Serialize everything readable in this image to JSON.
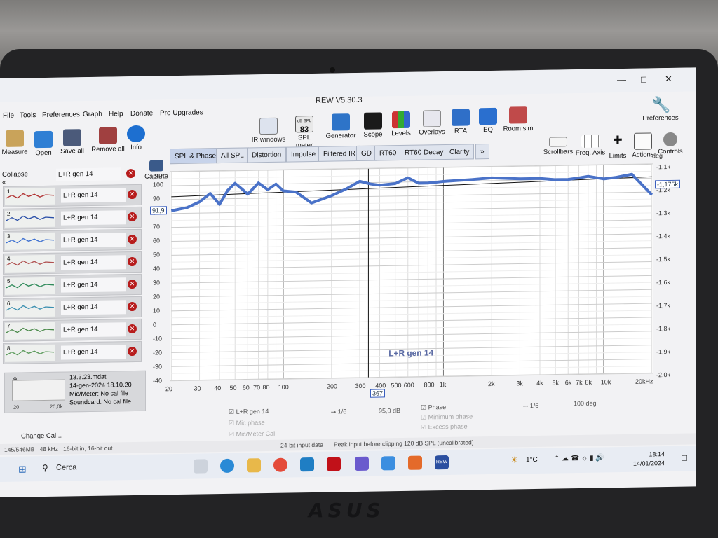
{
  "window": {
    "title": "REW V5.30.3"
  },
  "menu": [
    "File",
    "Tools",
    "Preferences",
    "Graph",
    "Help",
    "Donate",
    "Pro Upgrades"
  ],
  "toolbar_left": [
    "Measure",
    "Open",
    "Save all",
    "Remove all",
    "Info"
  ],
  "toolbar_center": [
    "IR windows",
    "SPL meter",
    "Generator",
    "Scope",
    "Levels",
    "Overlays",
    "RTA",
    "EQ",
    "Room sim"
  ],
  "spl_value": "83",
  "spl_icon_label": "dB SPL",
  "toolbar_right": [
    "Scrollbars",
    "Freq. Axis",
    "Limits",
    "Actions",
    "Controls"
  ],
  "preferences_label": "Preferences",
  "capture_label": "Capture",
  "sidebar": {
    "collapse_label": "Collapse",
    "top_name": "L+R gen 14",
    "items": [
      {
        "num": "1",
        "name": "L+R gen 14",
        "color": "#b03030"
      },
      {
        "num": "2",
        "name": "L+R gen 14",
        "color": "#2a4fa8"
      },
      {
        "num": "3",
        "name": "L+R gen 14",
        "color": "#3b6ed0"
      },
      {
        "num": "4",
        "name": "L+R gen 14",
        "color": "#b05050"
      },
      {
        "num": "5",
        "name": "L+R gen 14",
        "color": "#2f8a5a"
      },
      {
        "num": "6",
        "name": "L+R gen 14",
        "color": "#3a8fb0"
      },
      {
        "num": "7",
        "name": "L+R gen 14",
        "color": "#4a8a4a"
      },
      {
        "num": "8",
        "name": "L+R gen 14",
        "color": "#5a9a5a"
      }
    ],
    "details": {
      "num": "9",
      "file": "13.3.23.mdat",
      "date": "14-gen-2024 18.10.20",
      "mic": "Mic/Meter: No cal file",
      "sound": "Soundcard: No cal file",
      "range_start": "20",
      "range_end": "20,0k"
    },
    "change_cal": "Change Cal..."
  },
  "tabs": [
    "SPL & Phase",
    "All SPL",
    "Distortion",
    "Impulse",
    "Filtered IR",
    "GD",
    "RT60",
    "RT60 Decay",
    "Clarity",
    "»"
  ],
  "graph": {
    "y_unit": "SPL",
    "phase_unit": "deg",
    "y_ticks": [
      "100",
      "90",
      "80",
      "70",
      "60",
      "50",
      "40",
      "30",
      "20",
      "10",
      "0",
      "-10",
      "-20",
      "-30",
      "-40"
    ],
    "cursor_value": "91,9",
    "phase_ticks": [
      "-1,1k",
      "-1,2k",
      "-1,3k",
      "-1,4k",
      "-1,5k",
      "-1,6k",
      "-1,7k",
      "-1,8k",
      "-1,9k",
      "-2,0k"
    ],
    "phase_cursor": "-1,175k",
    "x_ticks": [
      "20",
      "30",
      "40",
      "50",
      "60",
      "70",
      "80",
      "100",
      "200",
      "300",
      "400",
      "500",
      "600",
      "800",
      "1k",
      "2k",
      "3k",
      "4k",
      "5k",
      "6k",
      "7k",
      "8k",
      "10k",
      "20kHz"
    ],
    "cursor_freq": "367",
    "trace_label": "L+R gen 14",
    "line_color": "#4a72c8"
  },
  "legend": {
    "spl_name": "L+R gen 14",
    "spl_smoothing": "1/6",
    "spl_value": "95,0 dB",
    "phase_name": "Phase",
    "phase_smoothing": "1/6",
    "phase_value": "100 deg",
    "mic_phase": "Mic phase",
    "mic_cal": "Mic/Meter Cal",
    "minimum_phase": "Minimum phase",
    "excess_phase": "Excess phase"
  },
  "status": {
    "memory": "145/546MB",
    "rate": "48 kHz",
    "bits": "16-bit in, 16-bit out",
    "input": "24-bit input data",
    "peak": "Peak input before clipping 120 dB SPL (uncalibrated)"
  },
  "taskbar": {
    "search": "Cerca",
    "temp": "1°C",
    "time": "18:14",
    "date": "14/01/2024",
    "rew_label": "REW"
  },
  "laptop_brand": "ASUS",
  "chart_data": {
    "type": "line",
    "ylabel": "SPL",
    "ylim": [
      -40,
      110
    ],
    "x": [
      20,
      25,
      30,
      35,
      40,
      45,
      50,
      55,
      60,
      70,
      80,
      90,
      100,
      120,
      150,
      200,
      250,
      300,
      350,
      400,
      500,
      600,
      700,
      800,
      1000,
      1500,
      2000,
      3000,
      4000,
      5000,
      6000,
      7000,
      8000,
      10000,
      12000,
      15000,
      20000
    ],
    "series": [
      {
        "name": "L+R gen 14",
        "values": [
          82,
          84,
          88,
          94,
          86,
          96,
          101,
          97,
          93,
          101,
          96,
          100,
          95,
          94,
          86,
          91,
          96,
          101,
          99,
          98,
          99,
          103,
          99,
          99,
          100,
          101,
          102,
          101,
          101,
          100,
          100,
          101,
          102,
          100,
          101,
          103,
          88
        ]
      }
    ]
  }
}
